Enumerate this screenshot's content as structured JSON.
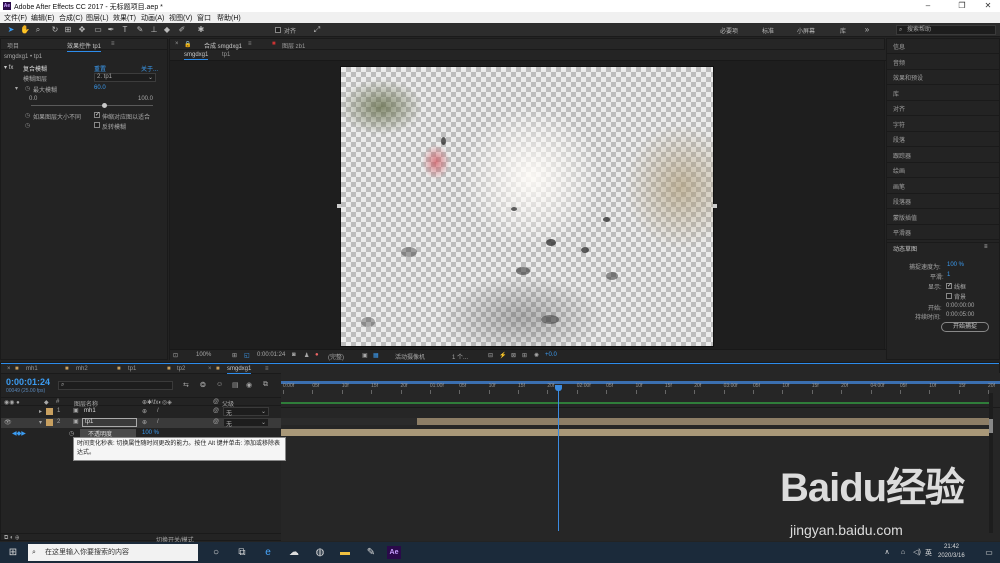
{
  "window": {
    "title": "Adobe After Effects CC 2017 - 无标题项目.aep *",
    "logo": "Ae"
  },
  "menu": [
    "文件(F)",
    "编辑(E)",
    "合成(C)",
    "图层(L)",
    "效果(T)",
    "动画(A)",
    "视图(V)",
    "窗口",
    "帮助(H)"
  ],
  "toolbar": {
    "align_label": "对齐",
    "workspaces": [
      "必要项",
      "标准",
      "小屏幕",
      "库"
    ],
    "search_placeholder": "搜索帮助"
  },
  "left_panel": {
    "tabs": [
      "项目",
      "效果控件 tp1"
    ],
    "breadcrumb": "smgdxg1 • tp1",
    "effect_name": "复合模糊",
    "reset_label": "重置",
    "about_label": "关于...",
    "blur_layer_label": "模糊图层",
    "blur_layer_value": "2. tp1",
    "max_blur_label": "最大模糊",
    "max_blur_value": "60.0",
    "slider_min": "0.0",
    "slider_max": "100.0",
    "max_blur_fraction": 0.6,
    "size_diff_label": "如果图层大小不同",
    "stretch_label": "伸缩对应图以适合",
    "invert_label": "反转模糊"
  },
  "comp_panel": {
    "tabs": [
      "合成 smgdxg1",
      "图层 zb1"
    ],
    "subtabs": [
      "smgdxg1",
      "tp1"
    ],
    "zoom": "100%",
    "timecode": "0:00:01:24",
    "resolution": "(完整)",
    "camera": "活动摄像机",
    "view_count": "1 个...",
    "exposure": "+0.0"
  },
  "right_panel": {
    "items": [
      "信息",
      "音频",
      "效果和预设",
      "库",
      "对齐",
      "字符",
      "段落",
      "跟踪器",
      "绘画",
      "画笔",
      "段落器",
      "蒙版插值",
      "平滑器"
    ],
    "motion_sketch": {
      "title": "动态草图",
      "speed_label": "捕捉速度为:",
      "speed_value": "100 %",
      "smooth_label": "平滑:",
      "smooth_value": "1",
      "display_label": "显示:",
      "wireframe_label": "线框",
      "background_label": "背景",
      "start_label": "开始:",
      "start_value": "0:00:00:00",
      "duration_label": "持续时间:",
      "duration_value": "0:00:05:00",
      "capture_button": "开始捕捉"
    }
  },
  "timeline": {
    "tabs": [
      "mh1",
      "mh2",
      "tp1",
      "tp2",
      "smgdxg1"
    ],
    "timecode": "0:00:01:24",
    "fps_info": "00049 (25.00 fps)",
    "col_layer_name": "图层名称",
    "col_parent": "父级",
    "layers": [
      {
        "num": "1",
        "name": "mh1",
        "parent": "无"
      },
      {
        "num": "2",
        "name": "tp1",
        "parent": "无"
      }
    ],
    "opacity_label": "不透明度",
    "opacity_value": "100 %",
    "ruler": [
      "0:00f",
      "05f",
      "10f",
      "15f",
      "20f",
      "01:00f",
      "05f",
      "10f",
      "15f",
      "20f",
      "02:00f",
      "05f",
      "10f",
      "15f",
      "20f",
      "03:00f",
      "05f",
      "10f",
      "15f",
      "20f",
      "04:00f",
      "05f",
      "10f",
      "15f",
      "20f"
    ],
    "toggle_label": "切换开关/模式",
    "tooltip": "时间变化秒表: 切换属性随时间更改的能力。按住 Alt 键并单击: 添加或移除表达式。"
  },
  "taskbar": {
    "search_placeholder": "在这里输入你要搜索的内容",
    "time": "21:42",
    "date": "2020/3/16",
    "lang": "英"
  },
  "watermark": {
    "brand": "Baidu经验",
    "url": "jingyan.baidu.com"
  }
}
